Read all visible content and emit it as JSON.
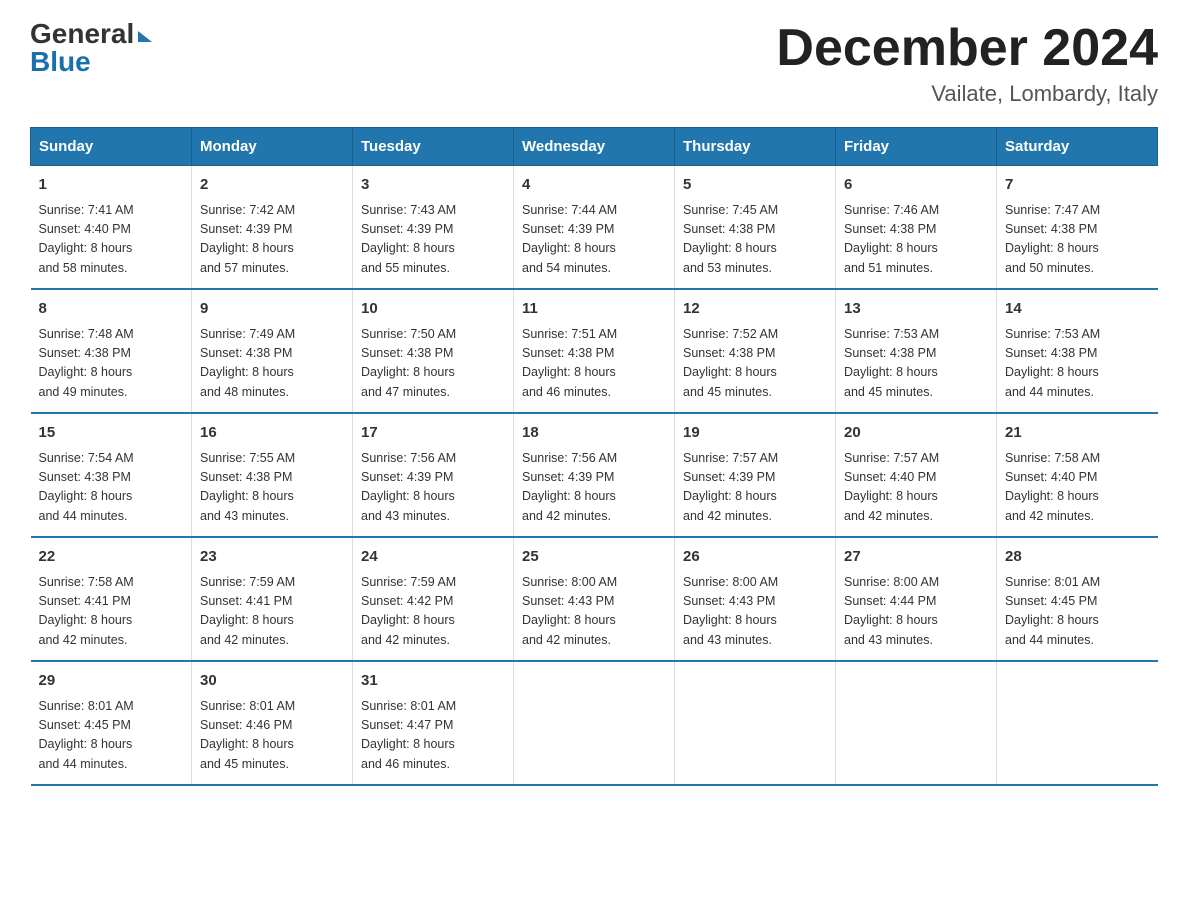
{
  "header": {
    "logo_general": "General",
    "logo_blue": "Blue",
    "month_title": "December 2024",
    "location": "Vailate, Lombardy, Italy"
  },
  "days_of_week": [
    "Sunday",
    "Monday",
    "Tuesday",
    "Wednesday",
    "Thursday",
    "Friday",
    "Saturday"
  ],
  "weeks": [
    [
      {
        "day": "1",
        "sunrise": "7:41 AM",
        "sunset": "4:40 PM",
        "daylight": "8 hours and 58 minutes."
      },
      {
        "day": "2",
        "sunrise": "7:42 AM",
        "sunset": "4:39 PM",
        "daylight": "8 hours and 57 minutes."
      },
      {
        "day": "3",
        "sunrise": "7:43 AM",
        "sunset": "4:39 PM",
        "daylight": "8 hours and 55 minutes."
      },
      {
        "day": "4",
        "sunrise": "7:44 AM",
        "sunset": "4:39 PM",
        "daylight": "8 hours and 54 minutes."
      },
      {
        "day": "5",
        "sunrise": "7:45 AM",
        "sunset": "4:38 PM",
        "daylight": "8 hours and 53 minutes."
      },
      {
        "day": "6",
        "sunrise": "7:46 AM",
        "sunset": "4:38 PM",
        "daylight": "8 hours and 51 minutes."
      },
      {
        "day": "7",
        "sunrise": "7:47 AM",
        "sunset": "4:38 PM",
        "daylight": "8 hours and 50 minutes."
      }
    ],
    [
      {
        "day": "8",
        "sunrise": "7:48 AM",
        "sunset": "4:38 PM",
        "daylight": "8 hours and 49 minutes."
      },
      {
        "day": "9",
        "sunrise": "7:49 AM",
        "sunset": "4:38 PM",
        "daylight": "8 hours and 48 minutes."
      },
      {
        "day": "10",
        "sunrise": "7:50 AM",
        "sunset": "4:38 PM",
        "daylight": "8 hours and 47 minutes."
      },
      {
        "day": "11",
        "sunrise": "7:51 AM",
        "sunset": "4:38 PM",
        "daylight": "8 hours and 46 minutes."
      },
      {
        "day": "12",
        "sunrise": "7:52 AM",
        "sunset": "4:38 PM",
        "daylight": "8 hours and 45 minutes."
      },
      {
        "day": "13",
        "sunrise": "7:53 AM",
        "sunset": "4:38 PM",
        "daylight": "8 hours and 45 minutes."
      },
      {
        "day": "14",
        "sunrise": "7:53 AM",
        "sunset": "4:38 PM",
        "daylight": "8 hours and 44 minutes."
      }
    ],
    [
      {
        "day": "15",
        "sunrise": "7:54 AM",
        "sunset": "4:38 PM",
        "daylight": "8 hours and 44 minutes."
      },
      {
        "day": "16",
        "sunrise": "7:55 AM",
        "sunset": "4:38 PM",
        "daylight": "8 hours and 43 minutes."
      },
      {
        "day": "17",
        "sunrise": "7:56 AM",
        "sunset": "4:39 PM",
        "daylight": "8 hours and 43 minutes."
      },
      {
        "day": "18",
        "sunrise": "7:56 AM",
        "sunset": "4:39 PM",
        "daylight": "8 hours and 42 minutes."
      },
      {
        "day": "19",
        "sunrise": "7:57 AM",
        "sunset": "4:39 PM",
        "daylight": "8 hours and 42 minutes."
      },
      {
        "day": "20",
        "sunrise": "7:57 AM",
        "sunset": "4:40 PM",
        "daylight": "8 hours and 42 minutes."
      },
      {
        "day": "21",
        "sunrise": "7:58 AM",
        "sunset": "4:40 PM",
        "daylight": "8 hours and 42 minutes."
      }
    ],
    [
      {
        "day": "22",
        "sunrise": "7:58 AM",
        "sunset": "4:41 PM",
        "daylight": "8 hours and 42 minutes."
      },
      {
        "day": "23",
        "sunrise": "7:59 AM",
        "sunset": "4:41 PM",
        "daylight": "8 hours and 42 minutes."
      },
      {
        "day": "24",
        "sunrise": "7:59 AM",
        "sunset": "4:42 PM",
        "daylight": "8 hours and 42 minutes."
      },
      {
        "day": "25",
        "sunrise": "8:00 AM",
        "sunset": "4:43 PM",
        "daylight": "8 hours and 42 minutes."
      },
      {
        "day": "26",
        "sunrise": "8:00 AM",
        "sunset": "4:43 PM",
        "daylight": "8 hours and 43 minutes."
      },
      {
        "day": "27",
        "sunrise": "8:00 AM",
        "sunset": "4:44 PM",
        "daylight": "8 hours and 43 minutes."
      },
      {
        "day": "28",
        "sunrise": "8:01 AM",
        "sunset": "4:45 PM",
        "daylight": "8 hours and 44 minutes."
      }
    ],
    [
      {
        "day": "29",
        "sunrise": "8:01 AM",
        "sunset": "4:45 PM",
        "daylight": "8 hours and 44 minutes."
      },
      {
        "day": "30",
        "sunrise": "8:01 AM",
        "sunset": "4:46 PM",
        "daylight": "8 hours and 45 minutes."
      },
      {
        "day": "31",
        "sunrise": "8:01 AM",
        "sunset": "4:47 PM",
        "daylight": "8 hours and 46 minutes."
      },
      null,
      null,
      null,
      null
    ]
  ],
  "labels": {
    "sunrise": "Sunrise:",
    "sunset": "Sunset:",
    "daylight": "Daylight:"
  }
}
